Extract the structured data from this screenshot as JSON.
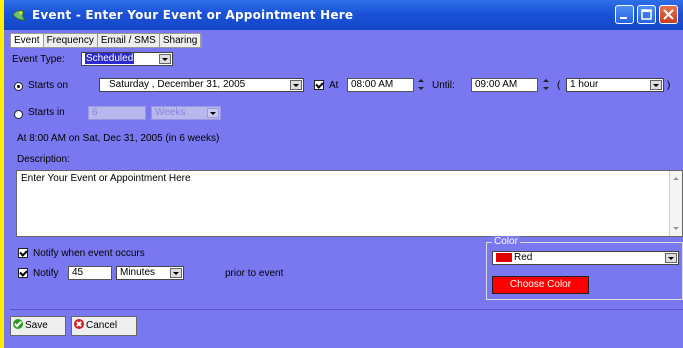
{
  "window": {
    "title": "Event - Enter Your Event or Appointment Here"
  },
  "tabs": [
    "Event",
    "Frequency",
    "Email / SMS",
    "Sharing"
  ],
  "event_type": {
    "label": "Event Type:",
    "value": "Scheduled"
  },
  "starts_on": {
    "label": "Starts on",
    "selected": true,
    "date": "Saturday , December 31, 2005",
    "at_label": "At",
    "at_checked": true,
    "time": "08:00 AM",
    "until_label": "Until:",
    "until_time": "09:00 AM",
    "paren_open": "(",
    "duration": "1 hour",
    "paren_close": ")"
  },
  "starts_in": {
    "label": "Starts in",
    "selected": false,
    "value": "6",
    "unit": "Weeks"
  },
  "summary": "At 8:00 AM on Sat, Dec 31, 2005 (in 6 weeks)",
  "description": {
    "label": "Description:",
    "text": "Enter Your Event or Appointment Here"
  },
  "notify_event": {
    "checked": true,
    "label": "Notify when event occurs"
  },
  "notify_prior": {
    "checked": true,
    "label": "Notify",
    "amount": "45",
    "unit": "Minutes",
    "suffix": "prior to event"
  },
  "color": {
    "legend": "Color",
    "selected": "Red",
    "swatch": "#e00000",
    "choose_label": "Choose Color"
  },
  "buttons": {
    "save": "Save",
    "cancel": "Cancel"
  },
  "colors": {
    "panel_bg": "#7a78f0",
    "titlebar": "#1a52d8",
    "desktop": "#ffee00"
  }
}
